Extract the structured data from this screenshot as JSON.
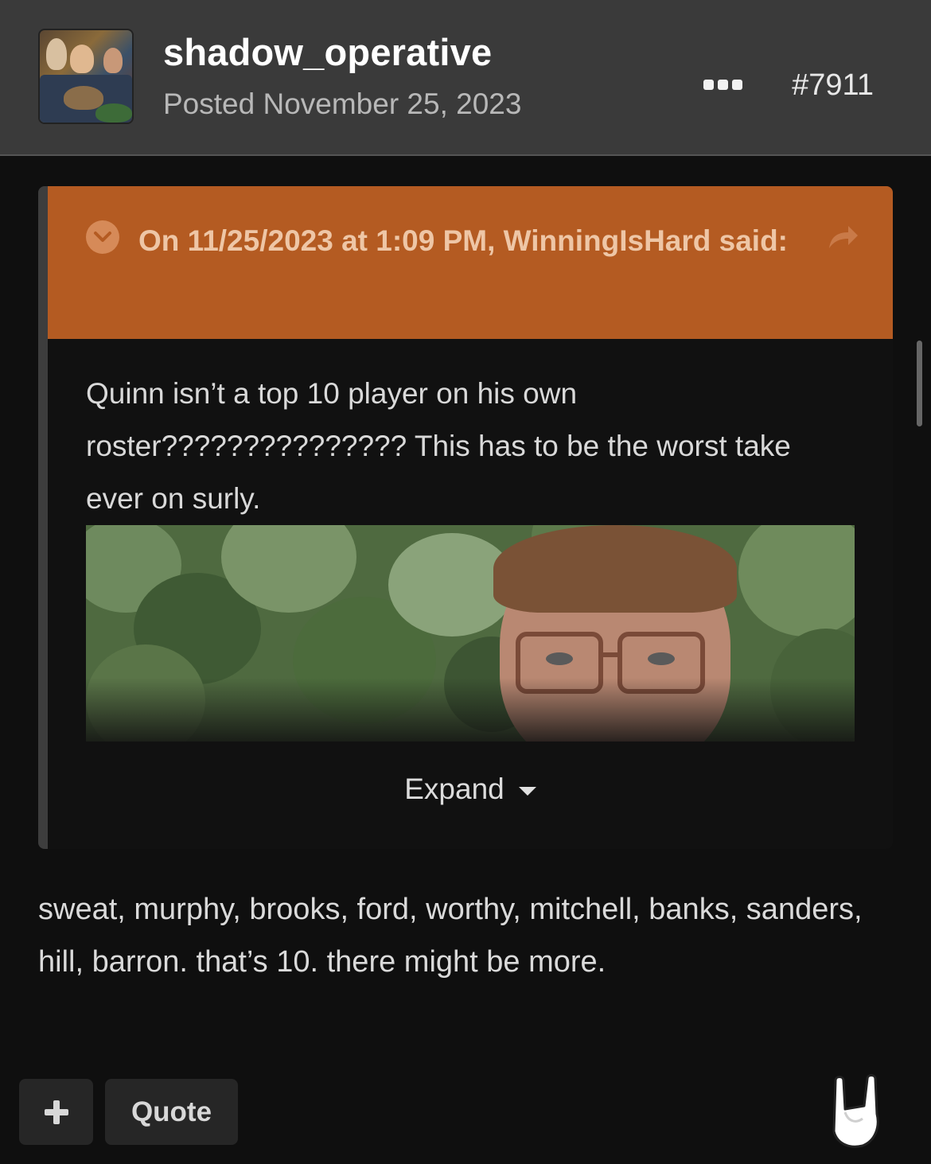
{
  "post": {
    "author": "shadow_operative",
    "posted": "Posted November 25, 2023",
    "number": "#7911",
    "menu_icon": "more-options-icon"
  },
  "quote": {
    "cite": "On 11/25/2023 at 1:09 PM, WinningIsHard said:",
    "body": "Quinn isn’t a top 10 player on his own roster??????????????? This has to be the worst take ever on surly.",
    "image_alt": "",
    "expand_label": "Expand"
  },
  "reply": {
    "body": "sweat, murphy, brooks, ford, worthy, mitchell, banks, sanders, hill, barron. that’s 10. there might be more."
  },
  "actions": {
    "plus_label": "+",
    "quote_label": "Quote",
    "reaction_icon": "rock-on-hand-icon"
  },
  "colors": {
    "header_bg": "#3a3a3a",
    "page_bg": "#0f0f0f",
    "quote_head_bg": "#b45b22",
    "quote_cite_text": "#eec6a6"
  }
}
